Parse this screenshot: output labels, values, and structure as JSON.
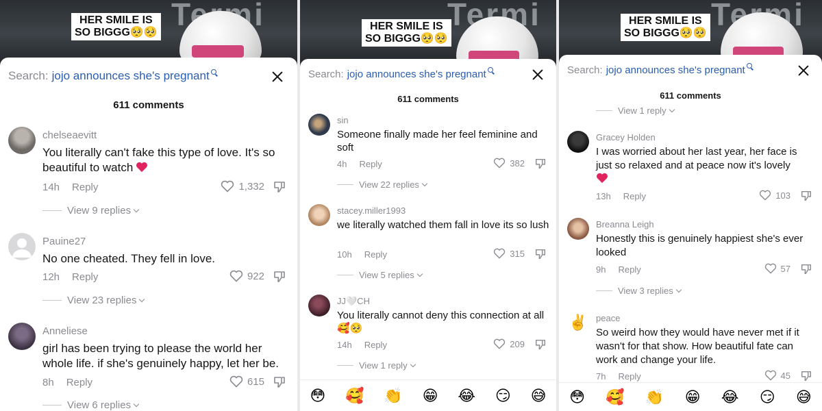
{
  "screens": [
    {
      "caption_line1": "HER SMILE IS",
      "caption_line2": "SO BIGGG🥺🥺",
      "search_prefix": "Search:",
      "search_term": "jojo announces she's pregnant",
      "comment_count": "611 comments",
      "comments": [
        {
          "user": "chelseaevitt",
          "text": "You literally can't fake this type of love. It's so beautiful to watch",
          "heart_emoji": true,
          "time": "14h",
          "reply": "Reply",
          "likes": "1,332",
          "view_replies": "View 9 replies",
          "avatar_color": "#6e6a66"
        },
        {
          "user": "Pauine27",
          "text": "No one cheated. They fell in love.",
          "heart_emoji": false,
          "time": "12h",
          "reply": "Reply",
          "likes": "922",
          "view_replies": "View 23 replies",
          "avatar_color": "#d9d9dc"
        },
        {
          "user": "Anneliese",
          "text": "girl has been trying to please the world her whole life. if she's genuinely happy, let her be.",
          "heart_emoji": false,
          "time": "8h",
          "reply": "Reply",
          "likes": "615",
          "view_replies": "View 6 replies",
          "avatar_color": "#4b4152"
        }
      ]
    },
    {
      "caption_line1": "HER SMILE IS",
      "caption_line2": "SO BIGGG🥺🥺",
      "search_prefix": "Search:",
      "search_term": "jojo announces she's pregnant",
      "comment_count": "611 comments",
      "comments": [
        {
          "user": "sin",
          "text": "Someone finally made her feel feminine and soft",
          "time": "4h",
          "reply": "Reply",
          "likes": "382",
          "view_replies": "View 22 replies",
          "avatar_color": "#2f3a4d"
        },
        {
          "user": "stacey.miller1993",
          "text": "we literally watched them fall in love its so lush",
          "time": "10h",
          "reply": "Reply",
          "likes": "315",
          "view_replies": "View 5 replies",
          "avatar_color": "#c9a58a"
        },
        {
          "user": "JJ🤍CH",
          "text": "You literally cannot deny this connection at all",
          "text_emojis": "🥰🥺",
          "time": "14h",
          "reply": "Reply",
          "likes": "209",
          "view_replies": "View 1 reply",
          "avatar_color": "#4a2733"
        }
      ],
      "emoji_bar": [
        "😳",
        "🥰",
        "👏",
        "😁",
        "😂",
        "😏",
        "😅"
      ]
    },
    {
      "caption_line1": "HER SMILE IS",
      "caption_line2": "SO BIGGG🥺🥺",
      "search_prefix": "Search:",
      "search_term": "jojo announces she's pregnant",
      "comment_count": "611 comments",
      "top_view_replies": "View 1 reply",
      "comments": [
        {
          "user": "Gracey Holden",
          "text": "I was worried about her last year, her face is just so relaxed and at peace now it's lovely",
          "heart_emoji": true,
          "time": "13h",
          "reply": "Reply",
          "likes": "103",
          "avatar_color": "#1e1e1e"
        },
        {
          "user": "Breanna Leigh",
          "text": "Honestly this is genuinely happiest she's ever looked",
          "time": "9h",
          "reply": "Reply",
          "likes": "57",
          "view_replies": "View 3 replies",
          "avatar_color": "#8a5a45"
        },
        {
          "user": "peace",
          "text": "So weird how they would have never met if it wasn't for that show. How beautiful fate can work and change your life.",
          "time": "7h",
          "reply": "Reply",
          "likes": "45",
          "avatar_emoji": "✌️",
          "avatar_color": "#ffffff"
        }
      ],
      "emoji_bar": [
        "😳",
        "🥰",
        "👏",
        "😁",
        "😂",
        "😏",
        "😅"
      ]
    }
  ],
  "colors": {
    "link_blue": "#2a5db0",
    "muted_gray": "#8a8b91",
    "heart_red": "#e0245e"
  }
}
